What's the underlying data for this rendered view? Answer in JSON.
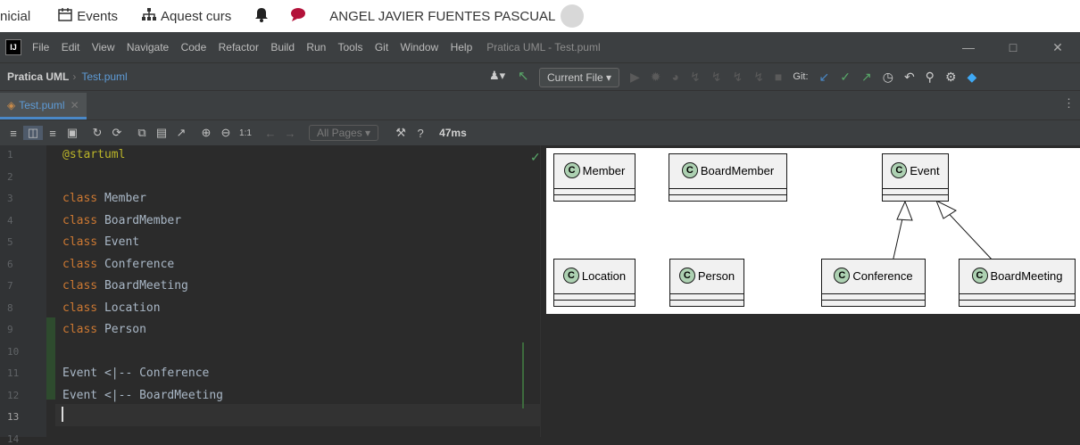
{
  "browser": {
    "items": [
      {
        "icon": "",
        "label": "nicial"
      },
      {
        "icon": "calendar-icon",
        "label": "Events"
      },
      {
        "icon": "sitemap-icon",
        "label": "Aquest curs"
      },
      {
        "icon": "bell-icon",
        "label": ""
      },
      {
        "icon": "chat-icon",
        "label": ""
      }
    ],
    "user_name": "ANGEL JAVIER FUENTES PASCUAL"
  },
  "ide": {
    "menu": [
      "File",
      "Edit",
      "View",
      "Navigate",
      "Code",
      "Refactor",
      "Build",
      "Run",
      "Tools",
      "Git",
      "Window",
      "Help"
    ],
    "window_title": "Pratica UML - Test.puml",
    "breadcrumb": [
      "Pratica UML",
      "Test.puml"
    ],
    "run_config": "Current File",
    "git_label": "Git:",
    "tab_label": "Test.puml",
    "all_pages": "All Pages",
    "zoom_ratio": "1:1",
    "render_time": "47ms"
  },
  "editor": {
    "line_numbers": [
      "1",
      "2",
      "3",
      "4",
      "5",
      "6",
      "7",
      "8",
      "9",
      "10",
      "11",
      "12",
      "13",
      "14"
    ],
    "lines": [
      {
        "kw": "",
        "text": "",
        "ann": "@startuml"
      },
      {
        "kw": "",
        "text": "",
        "ann": ""
      },
      {
        "kw": "class",
        "text": " Member",
        "ann": ""
      },
      {
        "kw": "class",
        "text": " BoardMember",
        "ann": ""
      },
      {
        "kw": "class",
        "text": " Event",
        "ann": ""
      },
      {
        "kw": "class",
        "text": " Conference",
        "ann": ""
      },
      {
        "kw": "class",
        "text": " BoardMeeting",
        "ann": ""
      },
      {
        "kw": "class",
        "text": " Location",
        "ann": ""
      },
      {
        "kw": "class",
        "text": " Person",
        "ann": ""
      },
      {
        "kw": "",
        "text": "",
        "ann": ""
      },
      {
        "kw": "",
        "text": "Event <|-- Conference",
        "ann": ""
      },
      {
        "kw": "",
        "text": "Event <|-- BoardMeeting",
        "ann": ""
      },
      {
        "kw": "",
        "text": "",
        "ann": ""
      },
      {
        "kw": "",
        "text": "",
        "ann": ""
      }
    ]
  },
  "diagram": {
    "class_marker": "C",
    "classes": [
      "Member",
      "BoardMember",
      "Event",
      "Location",
      "Person",
      "Conference",
      "BoardMeeting"
    ]
  }
}
